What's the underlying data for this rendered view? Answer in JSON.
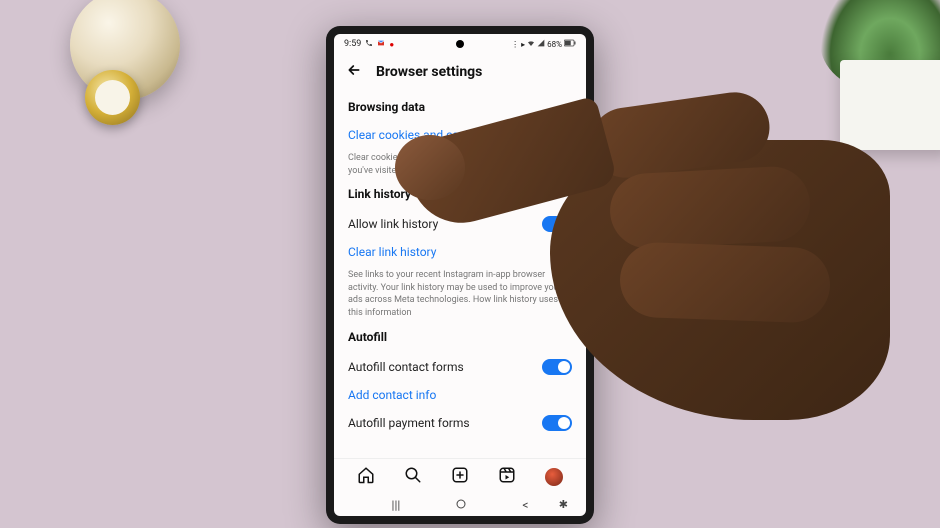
{
  "status_bar": {
    "time": "9:59",
    "battery_text": "68%"
  },
  "header": {
    "title": "Browser settings"
  },
  "sections": {
    "browsing_data": {
      "title": "Browsing data",
      "clear_link": "Clear cookies and cache",
      "description": "Clear cookies, cache and storage data from the sites you've visited while using Instagram."
    },
    "link_history": {
      "title": "Link history",
      "allow_label": "Allow link history",
      "allow_enabled": true,
      "clear_link": "Clear link history",
      "description": "See links to your recent Instagram in-app browser activity. Your link history may be used to improve your ads across Meta technologies. How link history uses this information"
    },
    "autofill": {
      "title": "Autofill",
      "contact_label": "Autofill contact forms",
      "contact_enabled": true,
      "add_contact_link": "Add contact info",
      "payment_label": "Autofill payment forms",
      "payment_enabled": true
    }
  }
}
